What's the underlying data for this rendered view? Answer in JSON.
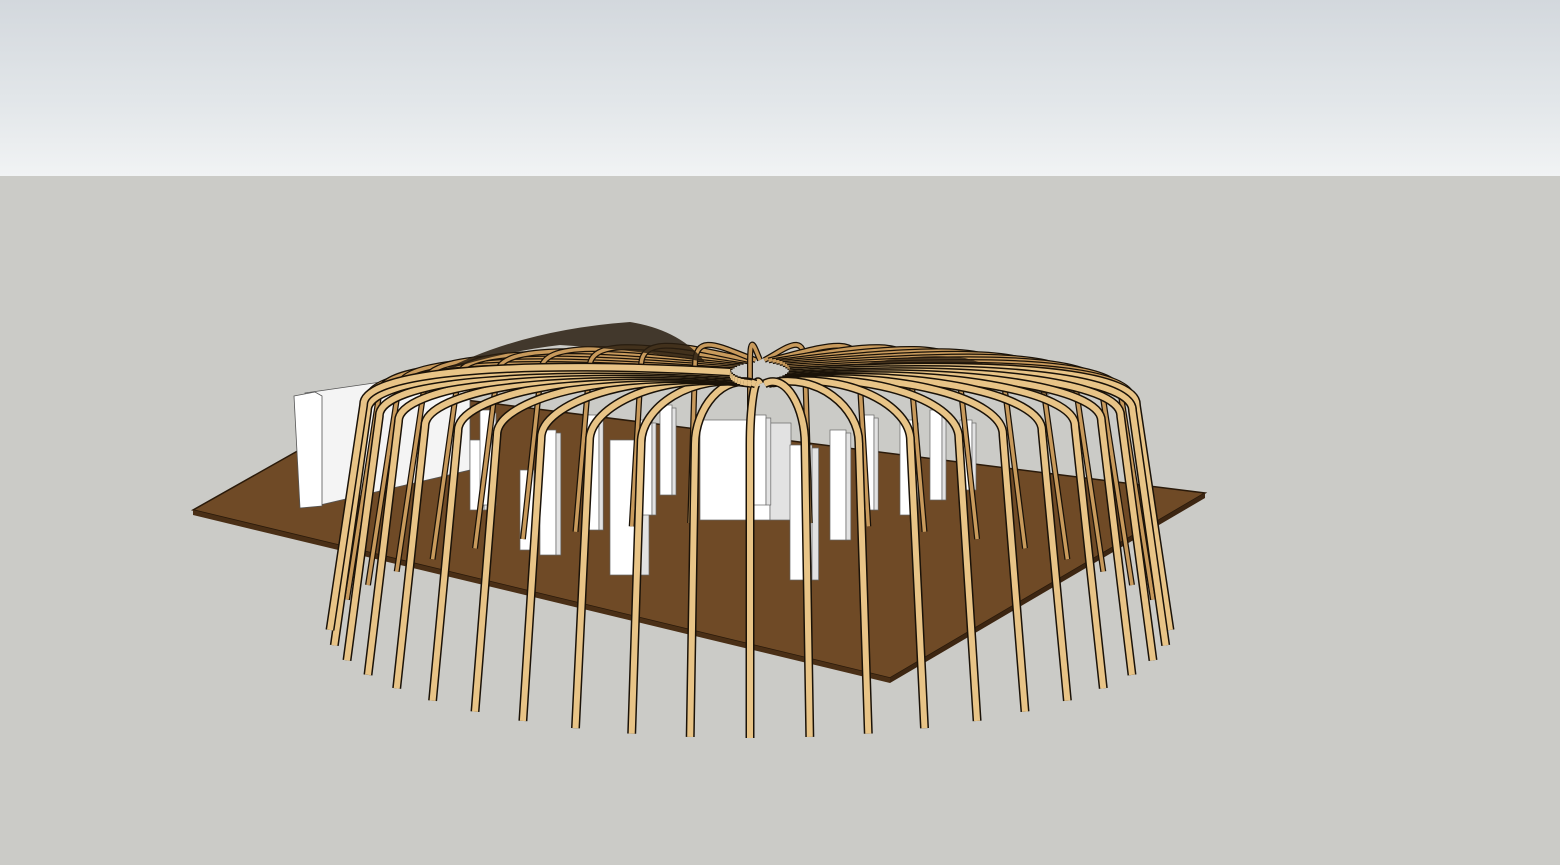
{
  "viewport": {
    "view": "3d-perspective",
    "model": "timber-gridshell-pavilion"
  },
  "colors": {
    "sky_top": "#d3d8dd",
    "sky_bottom": "#f1f3f4",
    "ground": "#cbcbc7",
    "platform": "#6f4a26",
    "rib_front": "#e8c487",
    "rib_back": "#c89a5c",
    "rib_edge": "#1a1208",
    "column": "#ffffff",
    "column_shade": "#e2e2e2",
    "wall": "#f4f4f4"
  }
}
